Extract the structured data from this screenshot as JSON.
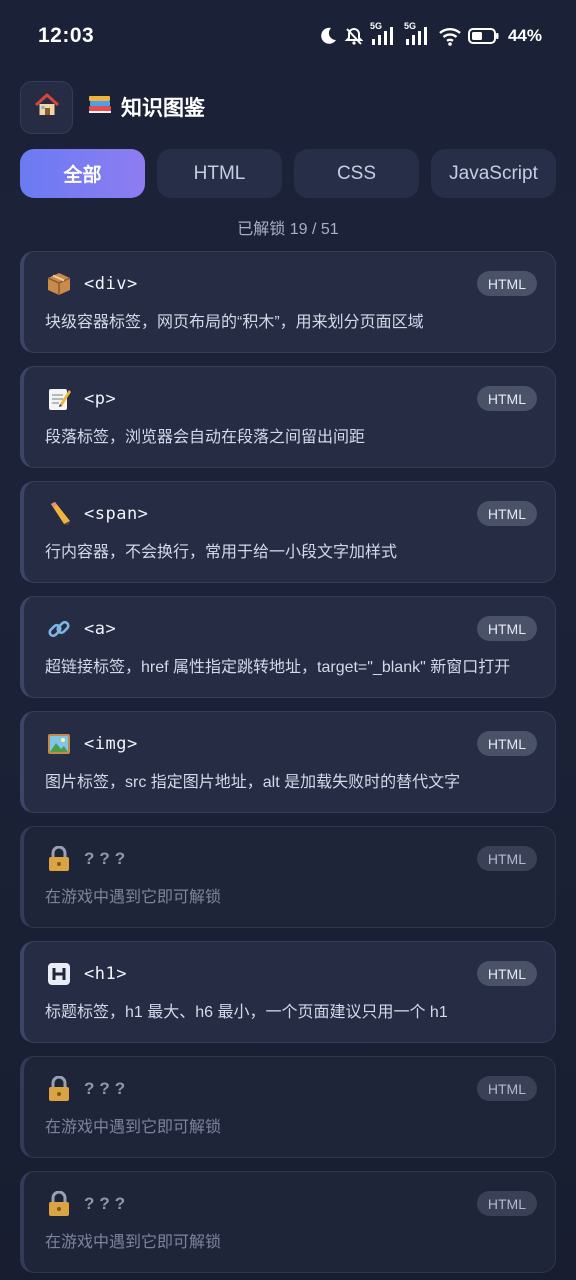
{
  "status_bar": {
    "time": "12:03",
    "network_1": "5G",
    "network_2": "5G",
    "battery": "44%",
    "icons": [
      "moon-icon",
      "bell-off-icon",
      "signal-icon",
      "signal-icon",
      "wifi-icon",
      "battery-icon"
    ]
  },
  "header": {
    "home_icon": "house-icon",
    "title_icon": "books-icon",
    "title": "知识图鉴"
  },
  "tabs": [
    {
      "label": "全部",
      "active": true
    },
    {
      "label": "HTML",
      "active": false
    },
    {
      "label": "CSS",
      "active": false
    },
    {
      "label": "JavaScript",
      "active": false
    }
  ],
  "progress": {
    "text": "已解锁 19 / 51",
    "unlocked": 19,
    "total": 51
  },
  "cards": [
    {
      "icon": "package-icon",
      "name": "<div>",
      "badge": "HTML",
      "desc": "块级容器标签，网页布局的“积木”，用来划分页面区域",
      "locked": false
    },
    {
      "icon": "memo-icon",
      "name": "<p>",
      "badge": "HTML",
      "desc": "段落标签，浏览器会自动在段落之间留出间距",
      "locked": false
    },
    {
      "icon": "pencil-icon",
      "name": "<span>",
      "badge": "HTML",
      "desc": "行内容器，不会换行，常用于给一小段文字加样式",
      "locked": false
    },
    {
      "icon": "link-icon",
      "name": "<a>",
      "badge": "HTML",
      "desc": "超链接标签，href 属性指定跳转地址，target=\"_blank\" 新窗口打开",
      "locked": false
    },
    {
      "icon": "picture-icon",
      "name": "<img>",
      "badge": "HTML",
      "desc": "图片标签，src 指定图片地址，alt 是加载失败时的替代文字",
      "locked": false
    },
    {
      "icon": "lock-icon",
      "name": "???",
      "badge": "HTML",
      "desc": "在游戏中遇到它即可解锁",
      "locked": true
    },
    {
      "icon": "h-letter-icon",
      "name": "<h1>",
      "badge": "HTML",
      "desc": "标题标签，h1 最大、h6 最小，一个页面建议只用一个 h1",
      "locked": false
    },
    {
      "icon": "lock-icon",
      "name": "???",
      "badge": "HTML",
      "desc": "在游戏中遇到它即可解锁",
      "locked": true
    },
    {
      "icon": "lock-icon",
      "name": "???",
      "badge": "HTML",
      "desc": "在游戏中遇到它即可解锁",
      "locked": true
    }
  ],
  "colors": {
    "background": "#1b2137",
    "card": "#252c44",
    "accent_start": "#6a7bf2",
    "accent_end": "#8e7cf1",
    "badge": "#4a5268"
  }
}
